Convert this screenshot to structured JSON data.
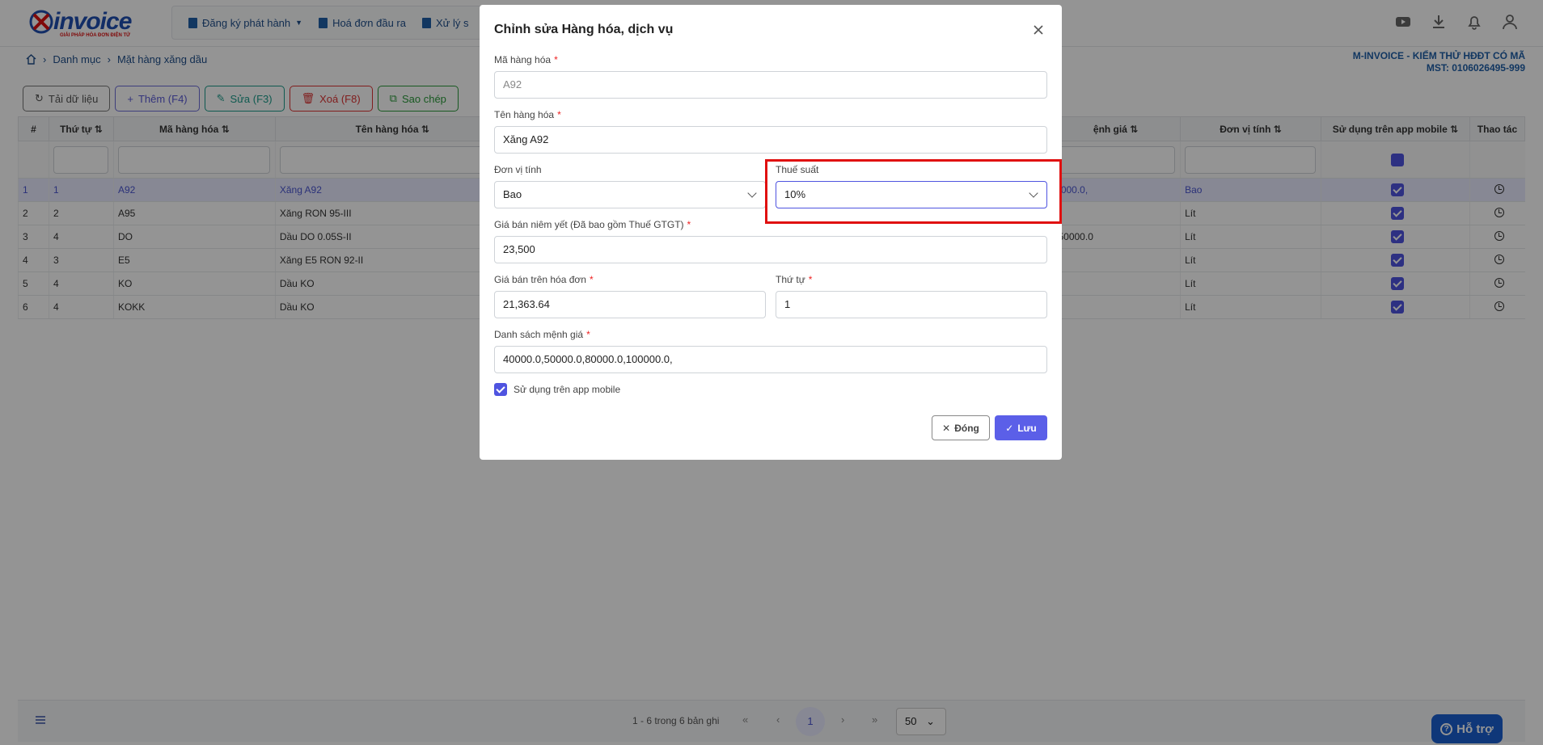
{
  "app": {
    "brand": "invoice",
    "tagline": "GIẢI PHÁP HÓA ĐƠN ĐIỆN TỬ"
  },
  "nav": {
    "items": [
      "Đăng ký phát hành",
      "Hoá đơn đầu ra",
      "Xử lý s"
    ]
  },
  "breadcrumb": {
    "items": [
      "Danh mục",
      "Mặt hàng xăng dầu"
    ]
  },
  "company": {
    "name": "M-INVOICE - KIỂM THỬ HĐĐT CÓ MÃ",
    "mst": "MST: 0106026495-999"
  },
  "toolbar": {
    "reload": "Tải dữ liệu",
    "add": "Thêm (F4)",
    "edit": "Sửa (F3)",
    "delete": "Xoá (F8)",
    "copy": "Sao chép"
  },
  "table": {
    "headers": {
      "idx": "#",
      "order": "Thứ tự",
      "code": "Mã hàng hóa",
      "name": "Tên hàng hóa",
      "denom": "ệnh giá",
      "unit": "Đơn vị tính",
      "mobile": "Sử dụng trên app mobile",
      "actions": "Thao tác"
    },
    "rows": [
      {
        "idx": "1",
        "order": "1",
        "code": "A92",
        "name": "Xăng A92",
        "denom": "0000.0,",
        "unit": "Bao",
        "mobile": true
      },
      {
        "idx": "2",
        "order": "2",
        "code": "A95",
        "name": "Xăng RON 95-III",
        "denom": "",
        "unit": "Lít",
        "mobile": true
      },
      {
        "idx": "3",
        "order": "4",
        "code": "DO",
        "name": "Dầu DO 0.05S-II",
        "denom": ",50000.0",
        "unit": "Lít",
        "mobile": true
      },
      {
        "idx": "4",
        "order": "3",
        "code": "E5",
        "name": "Xăng E5 RON 92-II",
        "denom": "",
        "unit": "Lít",
        "mobile": true
      },
      {
        "idx": "5",
        "order": "4",
        "code": "KO",
        "name": "Dầu KO",
        "denom": "",
        "unit": "Lít",
        "mobile": true
      },
      {
        "idx": "6",
        "order": "4",
        "code": "KOKK",
        "name": "Dầu KO",
        "denom": "",
        "unit": "Lít",
        "mobile": true
      }
    ]
  },
  "pager": {
    "info": "1 - 6 trong 6 bản ghi",
    "current": "1",
    "page_size": "50"
  },
  "support": {
    "label": "Hỗ trợ"
  },
  "modal": {
    "title": "Chỉnh sửa Hàng hóa, dịch vụ",
    "code_label": "Mã hàng hóa",
    "code_value": "A92",
    "name_label": "Tên hàng hóa",
    "name_value": "Xăng A92",
    "unit_label": "Đơn vị tính",
    "unit_value": "Bao",
    "tax_label": "Thuế suất",
    "tax_value": "10%",
    "list_price_label": "Giá bán niêm yết (Đã bao gồm Thuế GTGT)",
    "list_price_value": "23,500",
    "invoice_price_label": "Giá bán trên hóa đơn",
    "invoice_price_value": "21,363.64",
    "order_label": "Thứ tự",
    "order_value": "1",
    "denom_label": "Danh sách mệnh giá",
    "denom_value": "40000.0,50000.0,80000.0,100000.0,",
    "mobile_label": "Sử dụng trên app mobile",
    "mobile_checked": true,
    "close_label": "Đóng",
    "save_label": "Lưu"
  }
}
